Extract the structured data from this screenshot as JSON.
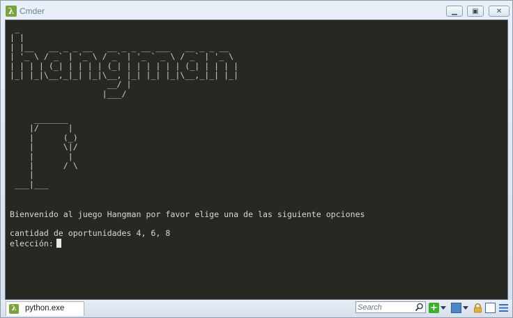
{
  "window": {
    "title": "Cmder",
    "app_icon_glyph": "λ",
    "controls": {
      "minimize_glyph": "▁",
      "maximize_glyph": "▣",
      "close_glyph": "✕"
    }
  },
  "terminal": {
    "banner_ascii": " _\n| |\n| |__   __ _ _ __   __ _ _ __ ___   __ _ _ __\n| '_ \\ / _` | '_ \\ / _` | '_ ` _ \\ / _` | '_ \\\n| | | | (_| | | | | (_| | | | | | | (_| | | | |\n|_| |_|\\__,_|_| |_|\\__, |_| |_| |_|\\__,_|_| |_|\n                    __/ |\n                   |___/",
    "gallows_ascii": "     _______\n    |/      |\n    |      (_)\n    |      \\|/\n    |       |\n    |      / \\\n    |\n ___|___",
    "welcome_line": "Bienvenido al juego Hangman por favor elige una de las siguiente opciones",
    "options_line": "cantidad de oportunidades 4, 6, 8",
    "prompt_line": "elección:"
  },
  "statusbar": {
    "tab_label": "python.exe",
    "tab_icon_glyph": "λ",
    "search_placeholder": "Search",
    "add_glyph": "+"
  },
  "colors": {
    "terminal_bg": "#272822",
    "terminal_fg": "#d4d4d0",
    "accent_green": "#7aa33a"
  },
  "icons": [
    "app-icon",
    "minimize-icon",
    "maximize-icon",
    "close-icon",
    "search-icon",
    "add-console-icon",
    "split-icon",
    "lock-icon",
    "view-icon",
    "menu-icon"
  ]
}
